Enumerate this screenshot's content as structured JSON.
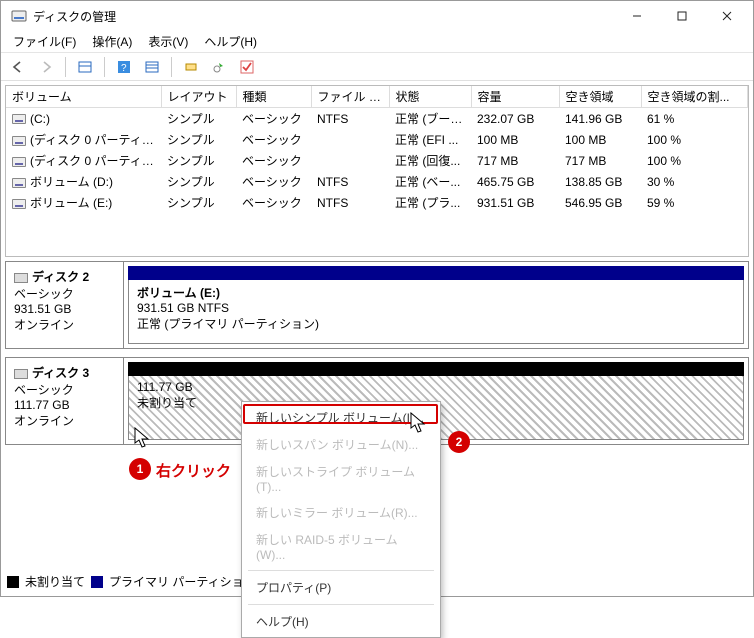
{
  "window": {
    "title": "ディスクの管理"
  },
  "menu": {
    "file": "ファイル(F)",
    "action": "操作(A)",
    "view": "表示(V)",
    "help": "ヘルプ(H)"
  },
  "columns": {
    "volume": "ボリューム",
    "layout": "レイアウト",
    "type": "種類",
    "fs": "ファイル システム",
    "status": "状態",
    "capacity": "容量",
    "free": "空き領域",
    "freepct": "空き領域の割..."
  },
  "rows": [
    {
      "volume": "(C:)",
      "layout": "シンプル",
      "type": "ベーシック",
      "fs": "NTFS",
      "status": "正常 (ブート...",
      "capacity": "232.07 GB",
      "free": "141.96 GB",
      "freepct": "61 %"
    },
    {
      "volume": "(ディスク 0 パーティシ...",
      "layout": "シンプル",
      "type": "ベーシック",
      "fs": "",
      "status": "正常 (EFI ...",
      "capacity": "100 MB",
      "free": "100 MB",
      "freepct": "100 %"
    },
    {
      "volume": "(ディスク 0 パーティシ...",
      "layout": "シンプル",
      "type": "ベーシック",
      "fs": "",
      "status": "正常 (回復...",
      "capacity": "717 MB",
      "free": "717 MB",
      "freepct": "100 %"
    },
    {
      "volume": "ボリューム (D:)",
      "layout": "シンプル",
      "type": "ベーシック",
      "fs": "NTFS",
      "status": "正常 (ベー...",
      "capacity": "465.75 GB",
      "free": "138.85 GB",
      "freepct": "30 %"
    },
    {
      "volume": "ボリューム (E:)",
      "layout": "シンプル",
      "type": "ベーシック",
      "fs": "NTFS",
      "status": "正常 (プラ...",
      "capacity": "931.51 GB",
      "free": "546.95 GB",
      "freepct": "59 %"
    }
  ],
  "disks": [
    {
      "name": "ディスク 2",
      "type": "ベーシック",
      "size": "931.51 GB",
      "status": "オンライン",
      "part": {
        "title": "ボリューム  (E:)",
        "sub": "931.51 GB NTFS",
        "state": "正常 (プライマリ パーティション)"
      },
      "headClass": "",
      "bodyClass": ""
    },
    {
      "name": "ディスク 3",
      "type": "ベーシック",
      "size": "111.77 GB",
      "status": "オンライン",
      "part": {
        "title": "",
        "sub": "111.77 GB",
        "state": "未割り当て"
      },
      "headClass": "black",
      "bodyClass": "hatch"
    }
  ],
  "legend": {
    "unalloc": "未割り当て",
    "primary": "プライマリ パーティション"
  },
  "context": {
    "items": [
      {
        "label": "新しいシンプル ボリューム(I)...",
        "disabled": false
      },
      {
        "label": "新しいスパン ボリューム(N)...",
        "disabled": true
      },
      {
        "label": "新しいストライプ ボリューム(T)...",
        "disabled": true
      },
      {
        "label": "新しいミラー ボリューム(R)...",
        "disabled": true
      },
      {
        "label": "新しい RAID-5 ボリューム(W)...",
        "disabled": true
      }
    ],
    "prop": "プロパティ(P)",
    "help": "ヘルプ(H)"
  },
  "annot": {
    "one": "1",
    "two": "2",
    "rightclick": "右クリック"
  }
}
